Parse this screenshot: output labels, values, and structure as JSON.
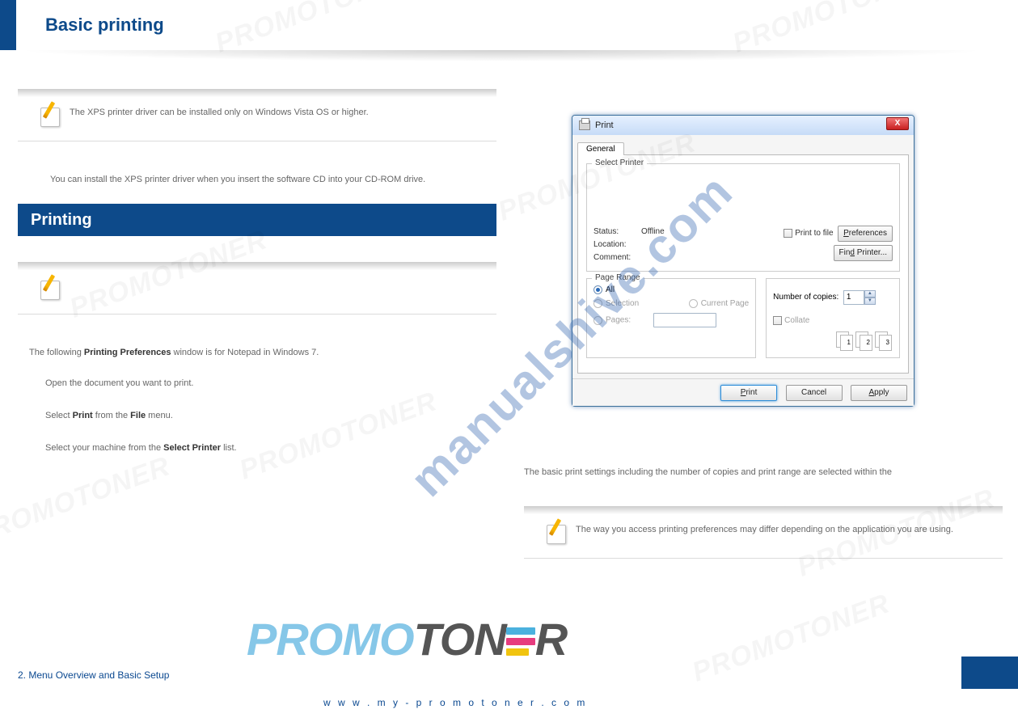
{
  "header": {
    "title": "Basic printing"
  },
  "notes": {
    "xps_driver": "The XPS printer driver can be installed only on Windows Vista OS or higher.",
    "note2": "",
    "note3": "The way you access printing preferences may differ depending on the application you are using."
  },
  "section": {
    "printing_heading": "Printing"
  },
  "body": {
    "xps_line": "You can install the XPS printer driver when you insert the software CD into your CD-ROM drive.",
    "par_before": "The following",
    "par_bold": " Printing Preferences ",
    "par_after": "window is for Notepad in Windows 7.",
    "step1": "Open the document you want to print.",
    "step2a": "Select ",
    "step2b": "Print",
    "step2c": " from the ",
    "step2d": "File",
    "step2e": " menu.",
    "step3a": "Select your machine from the ",
    "step3b": "Select Printer",
    "step3c": " list.",
    "right_par": "The basic print settings including the number of copies and print range are selected within the "
  },
  "print_dialog": {
    "title": "Print",
    "tab_general": "General",
    "select_printer": "Select Printer",
    "status_label": "Status:",
    "status_value": "Offline",
    "location_label": "Location:",
    "comment_label": "Comment:",
    "print_to_file": "Print to file",
    "preferences": "Preferences",
    "find_printer": "Find Printer...",
    "page_range": "Page Range",
    "all": "All",
    "selection": "Selection",
    "current_page": "Current Page",
    "pages": "Pages:",
    "num_copies": "Number of copies:",
    "copies_val": "1",
    "collate": "Collate",
    "stack1": "1",
    "stack2": "2",
    "stack3": "3",
    "btn_print": "Print",
    "btn_cancel": "Cancel",
    "btn_apply": "Apply",
    "close_x": "X"
  },
  "watermarks": {
    "big": "manualshive.com",
    "ghost": "PROMOTONER",
    "logo_a": "PROMO",
    "logo_b": "TON",
    "logo_c": "R"
  },
  "footer": {
    "break": "2.  Menu Overview and Basic Setup",
    "center": "w w w . m y - p r o m o t o n e r . c o m"
  }
}
